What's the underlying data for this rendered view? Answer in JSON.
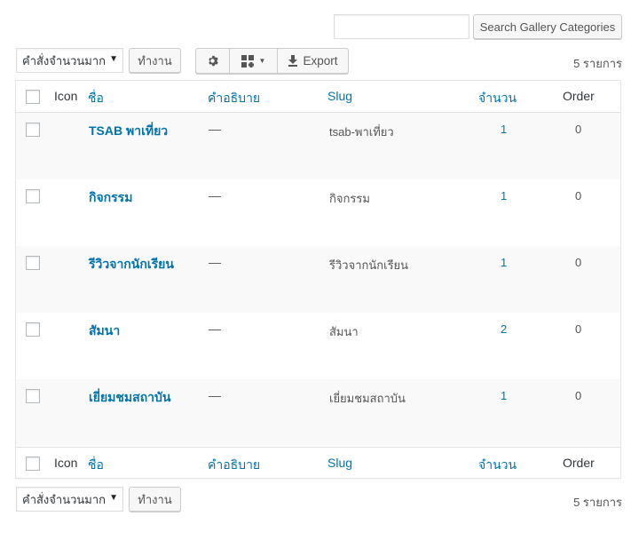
{
  "search": {
    "value": "",
    "button_label": "Search Gallery Categories"
  },
  "bulk": {
    "selected": "คำสั่งจำนวนมาก",
    "apply_label": "ทำงาน"
  },
  "toolbar": {
    "export_label": "Export",
    "icons": [
      "gear-icon",
      "grid-icon",
      "caret-down-icon",
      "download-icon"
    ]
  },
  "items_count": "5 รายการ",
  "columns": {
    "icon": "Icon",
    "name": "ชื่อ",
    "description": "คำอธิบาย",
    "slug": "Slug",
    "count": "จำนวน",
    "order": "Order"
  },
  "rows": [
    {
      "name": "TSAB พาเที่ยว",
      "description": "—",
      "slug": "tsab-พาเที่ยว",
      "count": "1",
      "order": "0"
    },
    {
      "name": "กิจกรรม",
      "description": "—",
      "slug": "กิจกรรม",
      "count": "1",
      "order": "0"
    },
    {
      "name": "รีวิวจากนักเรียน",
      "description": "—",
      "slug": "รีวิวจากนักเรียน",
      "count": "1",
      "order": "0"
    },
    {
      "name": "สัมนา",
      "description": "—",
      "slug": "สัมนา",
      "count": "2",
      "order": "0"
    },
    {
      "name": "เยี่ยมชมสถาบัน",
      "description": "—",
      "slug": "เยี่ยมชมสถาบัน",
      "count": "1",
      "order": "0"
    }
  ],
  "colors": {
    "link": "#0073aa",
    "row_alt": "#f9f9f9",
    "border": "#e5e5e5"
  }
}
